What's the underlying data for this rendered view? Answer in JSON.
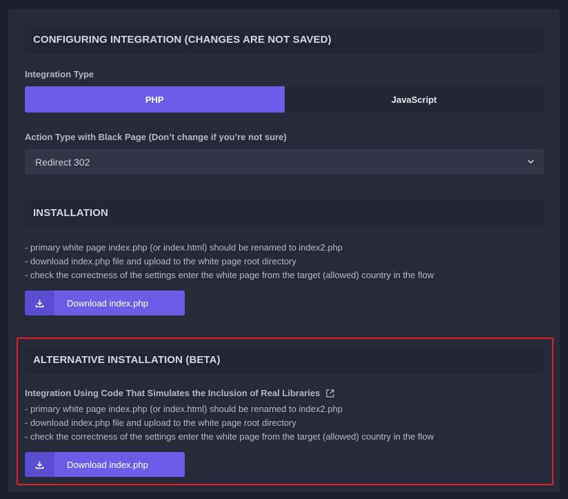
{
  "config": {
    "header": "CONFIGURING INTEGRATION (CHANGES ARE NOT SAVED)",
    "integration_type_label": "Integration Type",
    "integration_types": [
      "PHP",
      "JavaScript"
    ],
    "integration_type_selected": "PHP",
    "action_type_label": "Action Type with Black Page (Don’t change if you’re not sure)",
    "action_type_value": "Redirect 302"
  },
  "installation": {
    "header": "INSTALLATION",
    "lines": [
      "- primary white page index.php (or index.html) should be renamed to index2.php",
      "- download index.php file and upload to the white page root directory",
      "- check the correctness of the settings enter the white page from the target (allowed) country in the flow"
    ],
    "download_label": "Download index.php"
  },
  "alternative": {
    "header": "ALTERNATIVE INSTALLATION (BETA)",
    "link_text": "Integration Using Code That Simulates the Inclusion of Real Libraries",
    "lines": [
      "- primary white page index.php (or index.html) should be renamed to index2.php",
      "- download index.php file and upload to the white page root directory",
      "- check the correctness of the settings enter the white page from the target (allowed) country in the flow"
    ],
    "download_label": "Download index.php"
  },
  "icons": {
    "download": "download-icon",
    "chevron": "chevron-down-icon",
    "external": "external-link-icon"
  },
  "colors": {
    "accent": "#6c5ce7",
    "highlight": "#e01e1e",
    "panel": "#272a38",
    "background": "#1c1f2b"
  }
}
